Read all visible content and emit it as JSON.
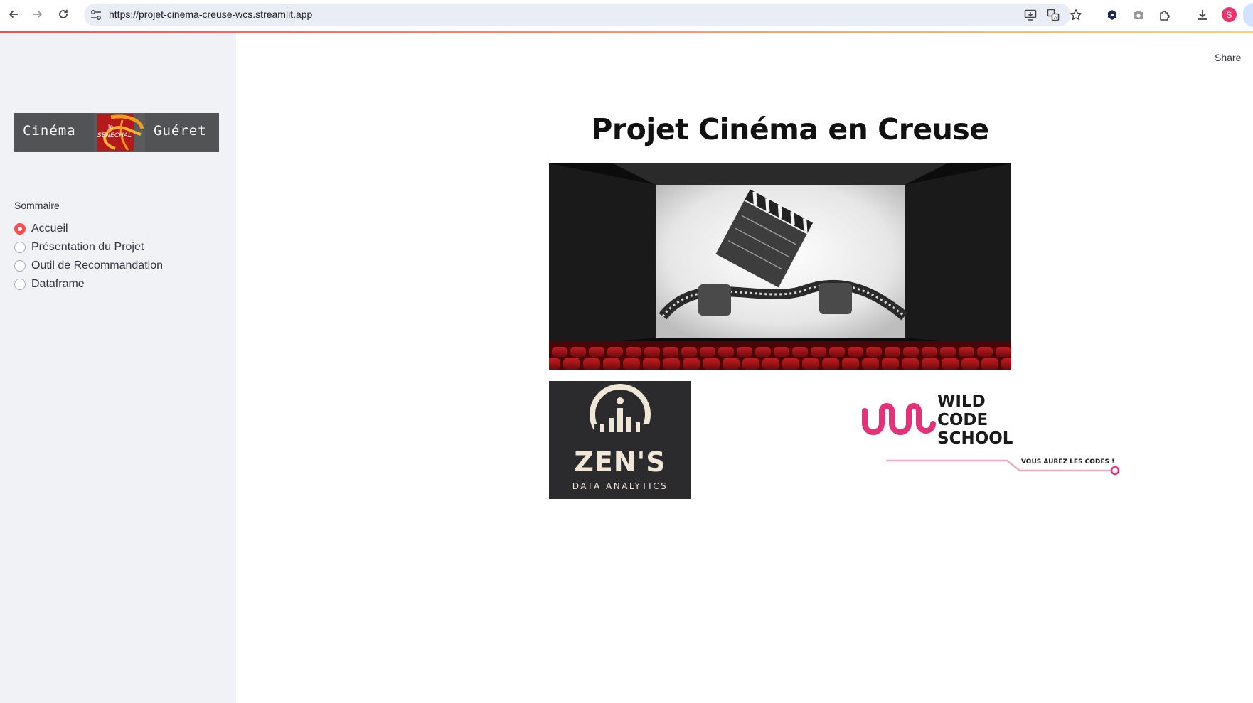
{
  "browser": {
    "url": "https://projet-cinema-creuse-wcs.streamlit.app",
    "profile_initial": "S",
    "icons": [
      "back-icon",
      "forward-icon",
      "reload-icon",
      "site-settings-icon",
      "install-app-icon",
      "translate-icon",
      "bookmark-star-icon",
      "extension-hex-icon",
      "camera-icon",
      "extensions-puzzle-icon",
      "download-icon"
    ]
  },
  "sidebar": {
    "logo": {
      "left_word": "Cinéma",
      "right_word": "Guéret",
      "emblem_text_top": "le",
      "emblem_text_main": "SENECHAL"
    },
    "nav_title": "Sommaire",
    "options": [
      {
        "label": "Accueil",
        "selected": true
      },
      {
        "label": "Présentation du Projet",
        "selected": false
      },
      {
        "label": "Outil de Recommandation",
        "selected": false
      },
      {
        "label": "Dataframe",
        "selected": false
      }
    ]
  },
  "main": {
    "share_label": "Share",
    "title": "Projet Cinéma en Creuse",
    "zens_logo": {
      "title": "ZEN'S",
      "subtitle": "DATA ANALYTICS"
    },
    "wcs_logo": {
      "line1": "WILD",
      "line2": "CODE",
      "line3": "SCHOOL",
      "tagline": "VOUS AUREZ LES CODES !"
    }
  },
  "colors": {
    "accent": "#ff4b4b",
    "sidebar_bg": "#f0f2f6",
    "wcs_pink": "#e5307a",
    "seat_red": "#a8151b"
  }
}
